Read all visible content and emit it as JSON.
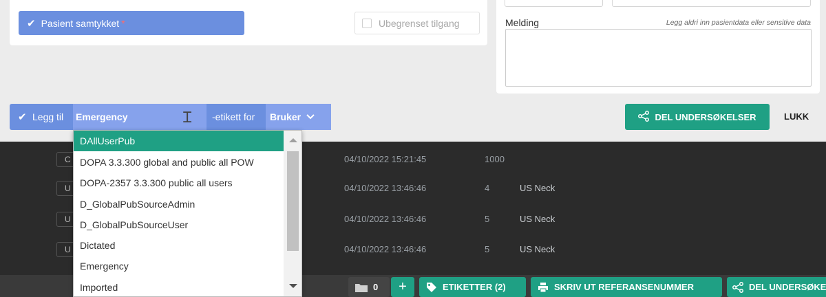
{
  "consent": {
    "label": "Pasient samtykket",
    "required_marker": "*"
  },
  "unlimited_access": {
    "label": "Ubegrenset tilgang"
  },
  "message": {
    "label": "Melding",
    "hint": "Legg aldri inn pasientdata eller sensitive data",
    "value": ""
  },
  "tag_bar": {
    "add_label": "Legg til",
    "tag_value": "Emergency",
    "middle_label": "-etikett for",
    "scope_value": "Bruker"
  },
  "actions": {
    "share_label": "DEL UNDERSØKELSER",
    "close_label": "LUKK"
  },
  "dropdown": {
    "options": [
      "DAllUserPub",
      "DOPA 3.3.300 global and public all POW",
      "DOPA-2357 3.3.300 public all users",
      "D_GlobalPubSourceAdmin",
      "D_GlobalPubSourceUser",
      "Dictated",
      "Emergency",
      "Imported"
    ],
    "highlighted": "DAllUserPub"
  },
  "table": {
    "rows": [
      {
        "chip": "C",
        "date": "04/10/2022 15:21:45",
        "count": "1000",
        "name": ""
      },
      {
        "chip": "U",
        "date": "04/10/2022 13:46:46",
        "count": "4",
        "name": "US Neck"
      },
      {
        "chip": "U",
        "date": "04/10/2022 13:46:46",
        "count": "5",
        "name": "US Neck"
      },
      {
        "chip": "U",
        "date": "04/10/2022 13:46:46",
        "count": "5",
        "name": "US Neck"
      }
    ]
  },
  "bottom_bar": {
    "count": "0",
    "plus": "+",
    "tags_label": "ETIKETTER (2)",
    "print_label": "SKRIV UT REFERANSENUMMER",
    "share_label": "DEL UNDERSØKELSER"
  },
  "colors": {
    "accent_blue": "#6b8fdf",
    "accent_green": "#1fa084",
    "dark_bg": "#2b2b2b"
  }
}
